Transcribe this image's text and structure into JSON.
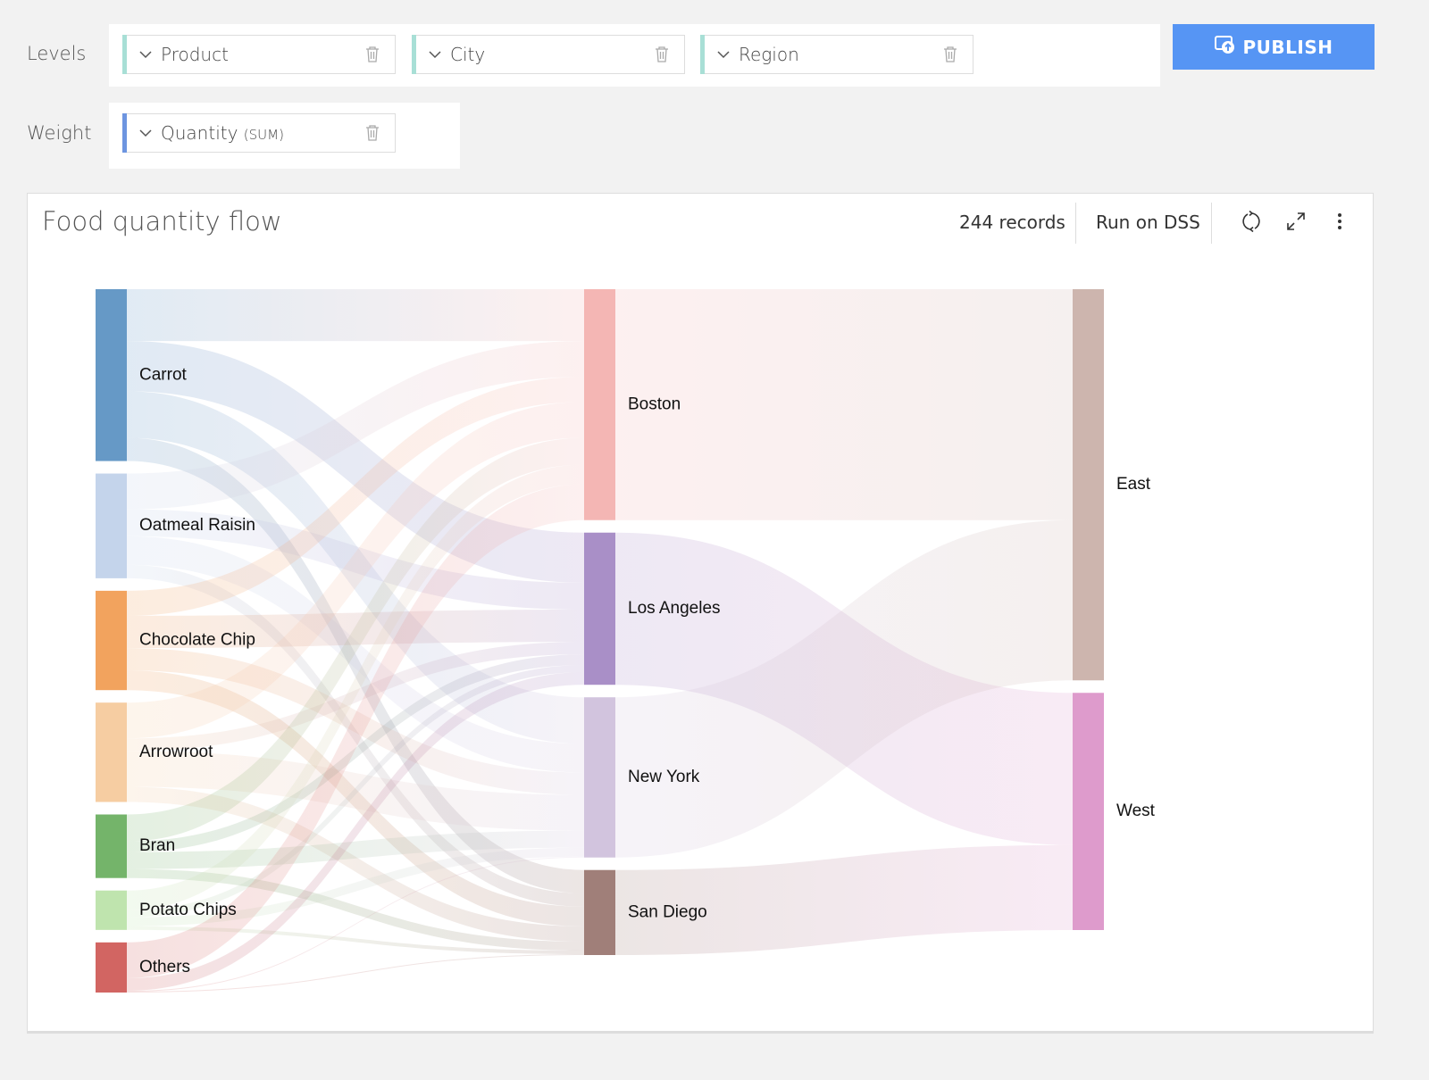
{
  "config": {
    "levels_label": "Levels",
    "weight_label": "Weight",
    "levels": [
      {
        "label": "Product",
        "accent": "#a8dfd6"
      },
      {
        "label": "City",
        "accent": "#a8dfd6"
      },
      {
        "label": "Region",
        "accent": "#a8dfd6"
      }
    ],
    "weight": {
      "label": "Quantity",
      "suffix": "(SUM)",
      "accent": "#6d95e0"
    },
    "publish_label": "PUBLISH"
  },
  "card": {
    "title": "Food quantity flow",
    "records": "244 records",
    "run_label": "Run on DSS"
  },
  "chart_data": {
    "type": "sankey",
    "title": "Food quantity flow",
    "levels": [
      "Product",
      "City",
      "Region"
    ],
    "weight": "Quantity (SUM)",
    "nodes": [
      {
        "id": "Carrot",
        "level": 0,
        "color": "#6699c6"
      },
      {
        "id": "Oatmeal Raisin",
        "level": 0,
        "color": "#c4d4eb"
      },
      {
        "id": "Chocolate Chip",
        "level": 0,
        "color": "#f2a35e"
      },
      {
        "id": "Arrowroot",
        "level": 0,
        "color": "#f6cda2"
      },
      {
        "id": "Bran",
        "level": 0,
        "color": "#74b46a"
      },
      {
        "id": "Potato Chips",
        "level": 0,
        "color": "#bfe4ae"
      },
      {
        "id": "Others",
        "level": 0,
        "color": "#d26562"
      },
      {
        "id": "Boston",
        "level": 1,
        "color": "#f4b6b4"
      },
      {
        "id": "Los Angeles",
        "level": 1,
        "color": "#a98fc7"
      },
      {
        "id": "New York",
        "level": 1,
        "color": "#d2c4de"
      },
      {
        "id": "San Diego",
        "level": 1,
        "color": "#a07f79"
      },
      {
        "id": "East",
        "level": 2,
        "color": "#cdb5ae"
      },
      {
        "id": "West",
        "level": 2,
        "color": "#de9bcc"
      }
    ],
    "links": [
      {
        "source": "Carrot",
        "target": "Boston",
        "value": 58
      },
      {
        "source": "Carrot",
        "target": "Los Angeles",
        "value": 56
      },
      {
        "source": "Carrot",
        "target": "New York",
        "value": 52
      },
      {
        "source": "Carrot",
        "target": "San Diego",
        "value": 26
      },
      {
        "source": "Oatmeal Raisin",
        "target": "Boston",
        "value": 40
      },
      {
        "source": "Oatmeal Raisin",
        "target": "Los Angeles",
        "value": 30
      },
      {
        "source": "Oatmeal Raisin",
        "target": "New York",
        "value": 32
      },
      {
        "source": "Oatmeal Raisin",
        "target": "San Diego",
        "value": 15
      },
      {
        "source": "Chocolate Chip",
        "target": "Boston",
        "value": 28
      },
      {
        "source": "Chocolate Chip",
        "target": "Los Angeles",
        "value": 36
      },
      {
        "source": "Chocolate Chip",
        "target": "New York",
        "value": 25
      },
      {
        "source": "Chocolate Chip",
        "target": "San Diego",
        "value": 22
      },
      {
        "source": "Arrowroot",
        "target": "Boston",
        "value": 40
      },
      {
        "source": "Arrowroot",
        "target": "Los Angeles",
        "value": 14
      },
      {
        "source": "Arrowroot",
        "target": "New York",
        "value": 40
      },
      {
        "source": "Arrowroot",
        "target": "San Diego",
        "value": 17
      },
      {
        "source": "Bran",
        "target": "Boston",
        "value": 30
      },
      {
        "source": "Bran",
        "target": "Los Angeles",
        "value": 12
      },
      {
        "source": "Bran",
        "target": "New York",
        "value": 19
      },
      {
        "source": "Bran",
        "target": "San Diego",
        "value": 10
      },
      {
        "source": "Potato Chips",
        "target": "Boston",
        "value": 22
      },
      {
        "source": "Potato Chips",
        "target": "Los Angeles",
        "value": 8
      },
      {
        "source": "Potato Chips",
        "target": "New York",
        "value": 10
      },
      {
        "source": "Potato Chips",
        "target": "San Diego",
        "value": 4
      },
      {
        "source": "Others",
        "target": "Boston",
        "value": 40
      },
      {
        "source": "Others",
        "target": "Los Angeles",
        "value": 14
      },
      {
        "source": "Others",
        "target": "New York",
        "value": 1
      },
      {
        "source": "Others",
        "target": "San Diego",
        "value": 1
      },
      {
        "source": "Boston",
        "target": "East",
        "value": 258
      },
      {
        "source": "Los Angeles",
        "target": "West",
        "value": 170
      },
      {
        "source": "New York",
        "target": "East",
        "value": 179
      },
      {
        "source": "San Diego",
        "target": "West",
        "value": 95
      }
    ]
  }
}
